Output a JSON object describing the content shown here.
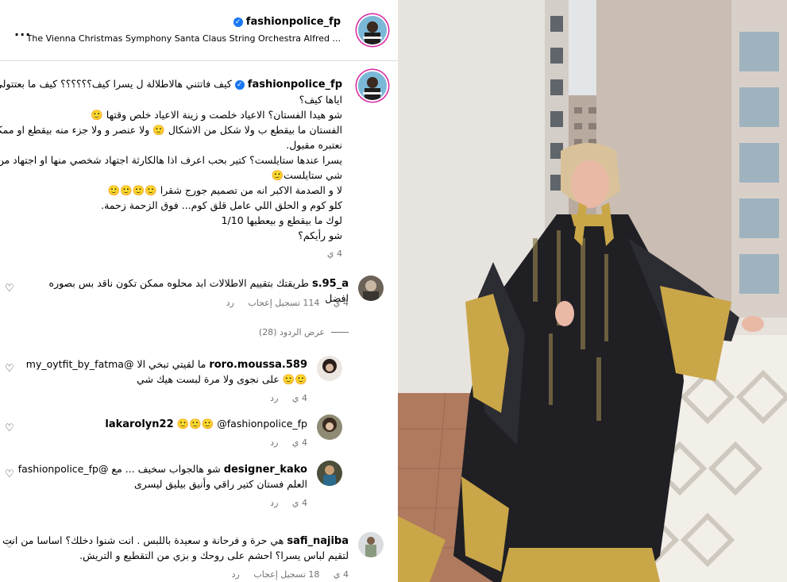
{
  "header": {
    "username": "fashionpolice_fp",
    "subtitle": "The Vienna Christmas Symphony Santa Claus String Orchestra Alfred ...",
    "more": "..."
  },
  "caption": {
    "username": "fashionpolice_fp",
    "lines": [
      "كيف فاتتني هالاطلالة ل يسرا كيف؟؟؟؟؟؟ كيف ما بعتتولي",
      "اياها كيف؟",
      "شو هيدا الفستان؟ الاعياد خلصت و زينة الاعياد خلص وقتها 🙂",
      "الفستان ما بيقطع ب ولا شكل من الاشكال 🙂 ولا عنصر و ولا جزء منه بيقطع او ممكن",
      "نعتبره مقبول.",
      "يسرا عندها ستايلست؟ كتير بحب اعرف اذا هالكارثة اجتهاد شخصي منها او اجتهاد من",
      "شي ستايلست🙂",
      "لا و الصدمة الاكبر انه من تصميم جورج شقرا 🙂🙂🙂🙂",
      "كلو كوم و الحلق اللي عامل قلق كوم... فوق الزحمة زحمة.",
      "لوك ما بيقطع و بيعطيها 1/10",
      "شو رأيكم؟"
    ],
    "time": "4 ي"
  },
  "comments": [
    {
      "username": "s.95_a",
      "text_lines": [
        "طريقتك بتقييم الاطلالات ابد محلوه ممكن تكون ناقد بس بصوره افضل"
      ],
      "time": "4 ي",
      "likes": "114 تسجيل إعجاب",
      "reply": "رد"
    },
    {
      "username": "roro.moussa.589",
      "text_lines": [
        "ما لقيتي تبخي الا @my_oytfit_by_fatma",
        "🙂🙂 على نجوى ولا مرة لبست هيك شي"
      ],
      "time": "4 ي",
      "reply": "رد"
    },
    {
      "username": "lakarolyn22",
      "text_lines": [
        "🙂🙂🙂 @fashionpolice_fp"
      ],
      "time": "4 ي",
      "reply": "رد"
    },
    {
      "username": "designer_kako",
      "text_lines": [
        "شو هالجواب سخيف ... مع @fashionpolice_fp",
        "العلم فستان كتير راقي وأنيق بيليق ليسرى"
      ],
      "time": "4 ي",
      "reply": "رد"
    },
    {
      "username": "safi_najiba",
      "text_lines": [
        "هي حرة و فرحانة و سعيدة باللبس . انت شنوا دخلك؟ اساسا من انت",
        "لتقيم لباس يسرا؟ احشم على روحك و بزي من التقطيع و التريش."
      ],
      "time": "4 ي",
      "likes": "18 تسجيل إعجاب",
      "reply": "رد"
    }
  ],
  "view_replies": "عرض الردود (28)",
  "icons": {
    "heart": "heart-outline-icon",
    "verified": "verified-badge-icon",
    "more": "more-horizontal-icon"
  },
  "colors": {
    "accent_ring": "#d6249f",
    "verified": "#1877f2",
    "muted": "#737373",
    "divider": "#dbdbdb"
  }
}
